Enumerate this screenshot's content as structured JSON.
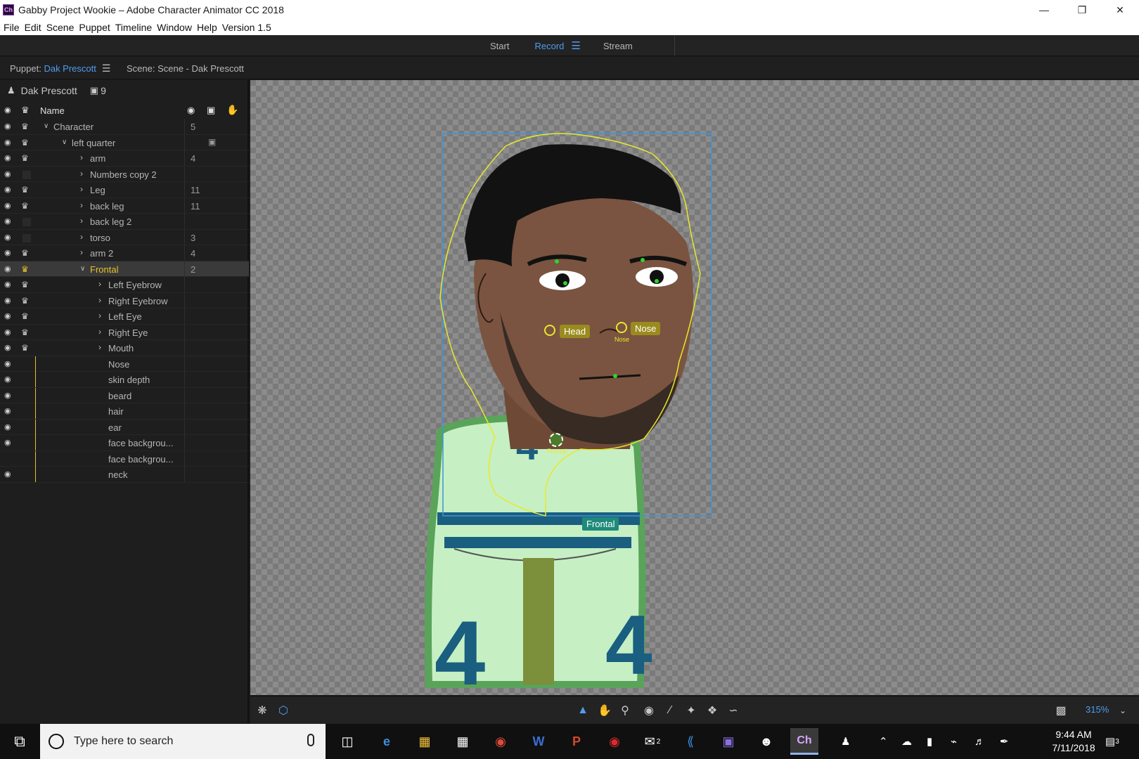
{
  "window": {
    "title": "Gabby Project Wookie – Adobe Character Animator CC 2018",
    "app_icon": "Ch",
    "controls": [
      "minimize-icon",
      "restore-icon",
      "close-icon"
    ]
  },
  "menubar": [
    "File",
    "Edit",
    "Scene",
    "Puppet",
    "Timeline",
    "Window",
    "Help",
    "Version 1.5"
  ],
  "workspace_tabs": [
    {
      "label": "Start",
      "active": false
    },
    {
      "label": "Record",
      "active": true
    },
    {
      "label": "Stream",
      "active": false
    }
  ],
  "panel_tabs": {
    "puppet_prefix": "Puppet:",
    "puppet_name": "Dak Prescott",
    "scene": "Scene: Scene - Dak Prescott"
  },
  "puppet_panel": {
    "name": "Dak Prescott",
    "camera_count": "9",
    "column_name": "Name",
    "rows": [
      {
        "label": "Character",
        "count": "5",
        "depth": 0,
        "arrow": "down",
        "eye": true,
        "crown": true
      },
      {
        "label": "left quarter",
        "count": "",
        "depth": 1,
        "arrow": "down",
        "eye": true,
        "crown": true,
        "camera": true
      },
      {
        "label": "arm",
        "count": "4",
        "depth": 2,
        "arrow": "right",
        "eye": true,
        "crown": true
      },
      {
        "label": "Numbers copy 2",
        "count": "",
        "depth": 2,
        "arrow": "right",
        "eye": true,
        "crown": false
      },
      {
        "label": "Leg",
        "count": "11",
        "depth": 2,
        "arrow": "right",
        "eye": true,
        "crown": true
      },
      {
        "label": "back leg",
        "count": "11",
        "depth": 2,
        "arrow": "right",
        "eye": true,
        "crown": true
      },
      {
        "label": "back leg 2",
        "count": "",
        "depth": 2,
        "arrow": "right",
        "eye": true,
        "crown": false
      },
      {
        "label": "torso",
        "count": "3",
        "depth": 2,
        "arrow": "right",
        "eye": true,
        "crown": false
      },
      {
        "label": "arm 2",
        "count": "4",
        "depth": 2,
        "arrow": "right",
        "eye": true,
        "crown": true
      },
      {
        "label": "Frontal",
        "count": "2",
        "depth": 2,
        "arrow": "down",
        "eye": true,
        "crown": true,
        "selected": true
      },
      {
        "label": "Left Eyebrow",
        "count": "",
        "depth": 3,
        "arrow": "right",
        "eye": true,
        "crown": true
      },
      {
        "label": "Right Eyebrow",
        "count": "",
        "depth": 3,
        "arrow": "right",
        "eye": true,
        "crown": true
      },
      {
        "label": "Left Eye",
        "count": "",
        "depth": 3,
        "arrow": "right",
        "eye": true,
        "crown": true
      },
      {
        "label": "Right Eye",
        "count": "",
        "depth": 3,
        "arrow": "right",
        "eye": true,
        "crown": true
      },
      {
        "label": "Mouth",
        "count": "",
        "depth": 3,
        "arrow": "right",
        "eye": true,
        "crown": true
      },
      {
        "label": "Nose",
        "count": "",
        "depth": 3,
        "arrow": "",
        "eye": true,
        "crown": null
      },
      {
        "label": "skin depth",
        "count": "",
        "depth": 3,
        "arrow": "",
        "eye": true,
        "crown": null
      },
      {
        "label": "beard",
        "count": "",
        "depth": 3,
        "arrow": "",
        "eye": true,
        "crown": null
      },
      {
        "label": "hair",
        "count": "",
        "depth": 3,
        "arrow": "",
        "eye": true,
        "crown": null
      },
      {
        "label": "ear",
        "count": "",
        "depth": 3,
        "arrow": "",
        "eye": true,
        "crown": null
      },
      {
        "label": "face backgrou...",
        "count": "",
        "depth": 3,
        "arrow": "",
        "eye": true,
        "crown": null
      },
      {
        "label": "face backgrou...",
        "count": "",
        "depth": 3,
        "arrow": "",
        "eye": false,
        "crown": null
      },
      {
        "label": "neck",
        "count": "",
        "depth": 3,
        "arrow": "",
        "eye": true,
        "crown": null
      }
    ]
  },
  "stage": {
    "handles": {
      "head": "Head",
      "nose": "Nose",
      "nose_small": "Nose",
      "frontal_small": "Frontal",
      "frontal_tag": "Frontal"
    },
    "jersey_number": "4"
  },
  "stage_toolbar": {
    "zoom": "315%"
  },
  "taskbar": {
    "search_placeholder": "Type here to search",
    "time": "9:44 AM",
    "date": "7/11/2018",
    "mail_badge": "2",
    "notif_badge": "3"
  },
  "colors": {
    "accent": "#4f9cf0",
    "selection": "#e8c02b",
    "stage_bbox": "#3f94d6",
    "mesh": "#e8e82b"
  }
}
